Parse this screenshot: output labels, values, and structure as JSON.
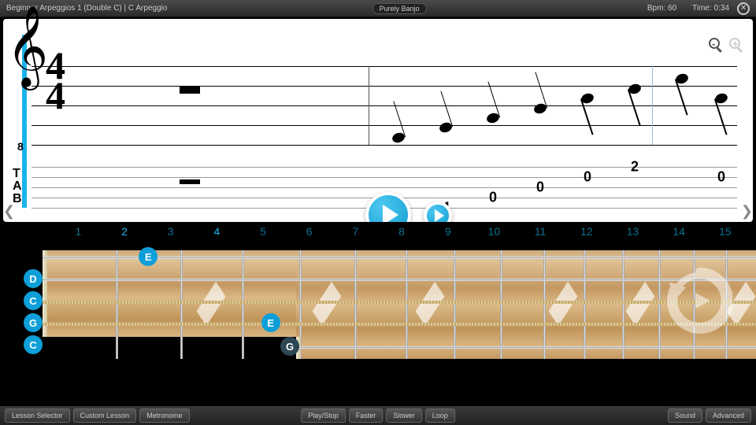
{
  "header": {
    "title": "Beginner Arpeggios 1 (Double C)  |  C Arpeggio",
    "brand": "Purely Banjo",
    "bpm_label": "Bpm: 60",
    "time_label": "Time: 0:34"
  },
  "score": {
    "timesig_top": "4",
    "timesig_bot": "4",
    "clef_sub": "8",
    "tab_label_t": "T",
    "tab_label_a": "A",
    "tab_label_b": "B",
    "tab_values": [
      "0",
      "4",
      "0",
      "0",
      "0",
      "2",
      "0"
    ]
  },
  "frets": {
    "numbers": [
      "1",
      "2",
      "3",
      "4",
      "5",
      "6",
      "7",
      "8",
      "9",
      "10",
      "11",
      "12",
      "13",
      "14",
      "15"
    ],
    "active": [
      1,
      3
    ]
  },
  "open_strings": [
    "D",
    "C",
    "G",
    "C"
  ],
  "fifth_string": "G",
  "fret_notes": [
    {
      "label": "E",
      "string": 0,
      "fret": 2
    },
    {
      "label": "E",
      "string": 3,
      "fret": 4
    }
  ],
  "buttons": {
    "left": [
      "Lesson Selector",
      "Custom Lesson",
      "Metronome"
    ],
    "center": [
      "Play/Stop",
      "Faster",
      "Slower",
      "Loop"
    ],
    "right": [
      "Sound",
      "Advanced"
    ]
  }
}
